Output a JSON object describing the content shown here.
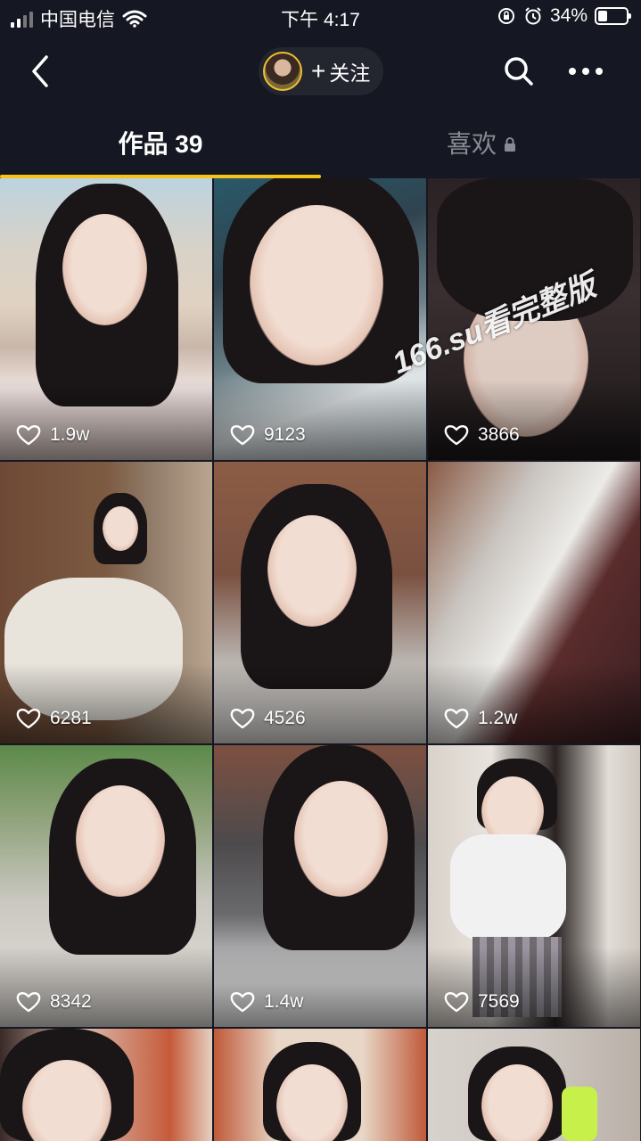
{
  "status_bar": {
    "carrier": "中国电信",
    "time": "下午 4:17",
    "battery": "34%",
    "battery_level": 0.34
  },
  "nav": {
    "follow_label": "关注",
    "icons": {
      "back": "back-arrow-icon",
      "search": "search-icon",
      "more": "more-dots-icon"
    }
  },
  "tabs": [
    {
      "label": "作品 39",
      "active": true
    },
    {
      "label": "喜欢",
      "active": false,
      "locked": true
    }
  ],
  "colors": {
    "background": "#151722",
    "tab_indicator": "#f6c21c",
    "pill": "#23252f",
    "inactive_tab": "#8a8b92"
  },
  "videos": [
    {
      "likes": "1.9w"
    },
    {
      "likes": "9123"
    },
    {
      "likes": "3866"
    },
    {
      "likes": "6281"
    },
    {
      "likes": "4526"
    },
    {
      "likes": "1.2w"
    },
    {
      "likes": "8342"
    },
    {
      "likes": "1.4w"
    },
    {
      "likes": "7569"
    },
    {
      "likes": ""
    },
    {
      "likes": ""
    },
    {
      "likes": ""
    }
  ],
  "watermark": "166.su看完整版"
}
